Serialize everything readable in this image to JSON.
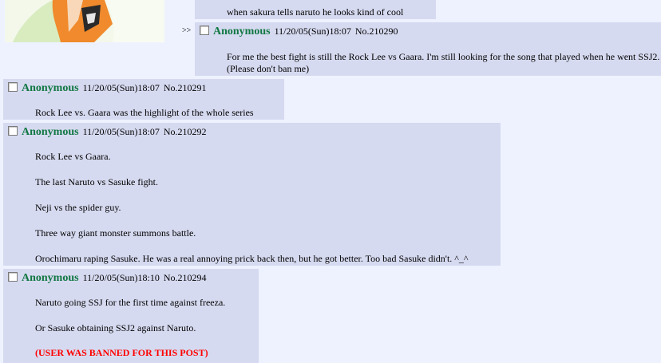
{
  "prev_post": {
    "line": "when sakura tells naruto he looks kind of cool"
  },
  "reply_marker": ">>",
  "posts": [
    {
      "name": "Anonymous",
      "datetime": "11/20/05(Sun)18:07",
      "number": "No.210290",
      "lines": [
        "For me the best fight is still the Rock Lee vs Gaara. I'm still looking for the song that played when he went SSJ2.",
        "(Please don't ban me)"
      ]
    },
    {
      "name": "Anonymous",
      "datetime": "11/20/05(Sun)18:07",
      "number": "No.210291",
      "lines": [
        "Rock Lee vs. Gaara was the highlight of the whole series"
      ]
    },
    {
      "name": "Anonymous",
      "datetime": "11/20/05(Sun)18:07",
      "number": "No.210292",
      "lines": [
        "Rock Lee vs Gaara.",
        "The last Naruto vs Sasuke fight.",
        "Neji vs the spider guy.",
        "Three way giant monster summons battle.",
        "Orochimaru raping Sasuke. He was a real annoying prick back then, but he got better. Too bad Sasuke didn't. ^_^"
      ]
    },
    {
      "name": "Anonymous",
      "datetime": "11/20/05(Sun)18:10",
      "number": "No.210294",
      "lines": [
        "Naruto going SSJ for the first time against freeza.",
        "Or Sasuke obtaining SSJ2 against Naruto."
      ],
      "ban_notice": "(USER WAS BANNED FOR THIS POST)"
    }
  ],
  "colors": {
    "name": "#117743",
    "post_bg": "#d6daf0",
    "page_bg": "#eef2ff",
    "ban": "#ff0000"
  }
}
